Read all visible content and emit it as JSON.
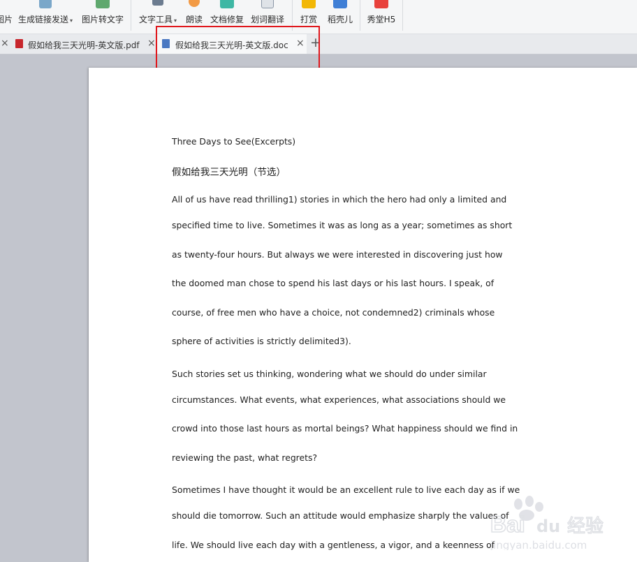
{
  "toolbar": {
    "items": [
      {
        "label": "图片"
      },
      {
        "label": "生成链接发送",
        "caret": "▾"
      },
      {
        "label": "图片转文字"
      },
      {
        "label": "文字工具",
        "caret": "▾"
      },
      {
        "label": "朗读"
      },
      {
        "label": "文档修复"
      },
      {
        "label": "划词翻译"
      },
      {
        "label": "打赏"
      },
      {
        "label": "稻壳儿"
      },
      {
        "label": "秀堂H5"
      }
    ]
  },
  "tabs": [
    {
      "label": "假如给我三天光明-英文版.pdf",
      "close": "×"
    },
    {
      "label": "假如给我三天光明-英文版.doc",
      "close": "×"
    }
  ],
  "new_tab_symbol": "+",
  "first_close": "×",
  "colors": {
    "highlight_border": "#e0171c",
    "pdf_icon": "#c7262c",
    "doc_icon": "#4a78c2",
    "page_bg": "#ffffff",
    "workspace_bg": "#c2c5cd"
  },
  "document": {
    "title_en": "Three Days to See(Excerpts)",
    "title_cn": "假如给我三天光明（节选）",
    "lines": [
      "All of us have read thrilling1) stories in which the hero had only a limited and",
      "specified time to live. Sometimes it was as long as a year; sometimes as short",
      "as twenty-four hours. But always we were interested in discovering just how",
      "the doomed man chose to spend his last days or his last hours. I speak, of",
      "course, of free men who have a choice, not condemned2) criminals whose",
      "sphere of activities is strictly delimited3).",
      "Such stories set us thinking, wondering what we should do under similar",
      "circumstances. What events, what experiences, what associations should we",
      "crowd into those last hours as mortal beings? What happiness should we find in",
      "reviewing the past, what regrets?",
      "Sometimes I have thought it would be an excellent rule to live each day as if we",
      "should die tomorrow. Such an attitude would emphasize sharply the values of",
      "life. We should live each day with a gentleness, a vigor, and a keenness of"
    ]
  },
  "watermark": {
    "brand": "Bai",
    "brand_cn": "经验",
    "url": "jingyan.baidu.com"
  }
}
